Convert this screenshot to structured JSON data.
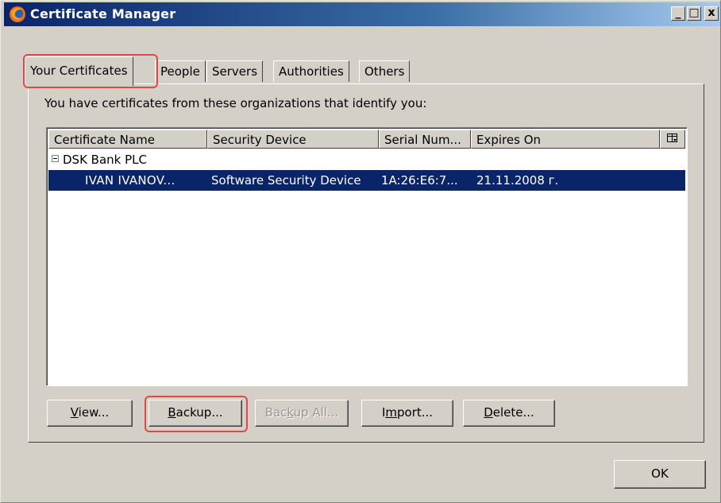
{
  "window": {
    "title": "Certificate Manager",
    "controls": {
      "minimize": "_",
      "maximize": "□",
      "close": "x"
    }
  },
  "tabs": [
    {
      "label": "Your Certificates",
      "active": true
    },
    {
      "label": "People"
    },
    {
      "label": "Servers"
    },
    {
      "label": "Authorities"
    },
    {
      "label": "Others"
    }
  ],
  "panel": {
    "intro": "You have certificates from these organizations that identify you:"
  },
  "table": {
    "columns": [
      "Certificate Name",
      "Security Device",
      "Serial Num...",
      "Expires On"
    ],
    "column_picker_icon": "column-picker-icon",
    "groups": [
      {
        "name": "DSK Bank PLC",
        "expanded": true,
        "rows": [
          {
            "name": "IVAN IVANOV...",
            "device": "Software Security Device",
            "serial": "1A:26:E6:7...",
            "expires": "21.11.2008 г.",
            "selected": true
          }
        ]
      }
    ]
  },
  "buttons": {
    "view": {
      "pre": "",
      "acc": "V",
      "post": "iew..."
    },
    "backup": {
      "pre": "",
      "acc": "B",
      "post": "ackup..."
    },
    "backup_all": {
      "pre": "Bac",
      "acc": "k",
      "post": "up All..."
    },
    "import": {
      "pre": "I",
      "acc": "m",
      "post": "port..."
    },
    "delete": {
      "pre": "",
      "acc": "D",
      "post": "elete..."
    },
    "ok": "OK"
  },
  "colors": {
    "selection": "#0a246a",
    "highlight": "#e04848",
    "face": "#d4d0c8"
  }
}
